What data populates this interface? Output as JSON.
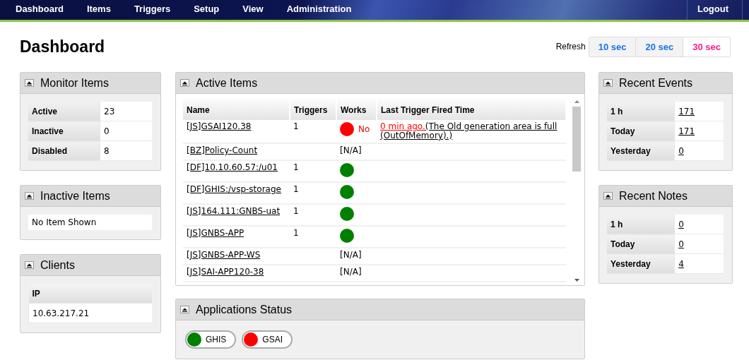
{
  "nav": {
    "items": [
      {
        "label": "Dashboard"
      },
      {
        "label": "Items"
      },
      {
        "label": "Triggers"
      },
      {
        "label": "Setup"
      },
      {
        "label": "View"
      },
      {
        "label": "Administration"
      }
    ],
    "logout": "Logout"
  },
  "page_title": "Dashboard",
  "refresh": {
    "label": "Refresh",
    "options": [
      {
        "label": "10 sec",
        "selected": false
      },
      {
        "label": "20 sec",
        "selected": false
      },
      {
        "label": "30 sec",
        "selected": true
      }
    ]
  },
  "monitor_items": {
    "title": "Monitor Items",
    "rows": [
      {
        "label": "Active",
        "value": "23"
      },
      {
        "label": "Inactive",
        "value": "0"
      },
      {
        "label": "Disabled",
        "value": "8"
      }
    ]
  },
  "inactive_items": {
    "title": "Inactive Items",
    "message": "No Item Shown"
  },
  "clients": {
    "title": "Clients",
    "column": "IP",
    "rows": [
      "10.63.217.21"
    ]
  },
  "active_items": {
    "title": "Active Items",
    "columns": [
      "Name",
      "Triggers",
      "Works",
      "Last Trigger Fired Time"
    ],
    "rows": [
      {
        "name": "[JS]GSAI120.38",
        "triggers": "1",
        "works": {
          "kind": "dot",
          "color": "#ff0000",
          "label": "No"
        },
        "last_trigger": {
          "time": "0 min ago.",
          "message": "(The Old generation area is full (OutOfMemory).)"
        }
      },
      {
        "name": "[BZ]Policy-Count",
        "works": {
          "kind": "text",
          "label": "[N/A]"
        }
      },
      {
        "name": "[DF]10.10.60.57:/u01",
        "triggers": "1",
        "works": {
          "kind": "dot",
          "color": "#008000"
        }
      },
      {
        "name": "[DF]GHIS:/vsp-storage",
        "triggers": "1",
        "works": {
          "kind": "dot",
          "color": "#008000"
        }
      },
      {
        "name": "[JS]164.111:GNBS-uat",
        "triggers": "1",
        "works": {
          "kind": "dot",
          "color": "#008000"
        }
      },
      {
        "name": "[JS]GNBS-APP",
        "triggers": "1",
        "works": {
          "kind": "dot",
          "color": "#008000"
        }
      },
      {
        "name": "[JS]GNBS-APP-WS",
        "works": {
          "kind": "text",
          "label": "[N/A]"
        }
      },
      {
        "name": "[JS]SAI-APP120-38",
        "works": {
          "kind": "text",
          "label": "[N/A]"
        }
      }
    ]
  },
  "applications_status": {
    "title": "Applications Status",
    "apps": [
      {
        "name": "GHIS",
        "color": "#008000"
      },
      {
        "name": "GSAI",
        "color": "#ff0000"
      }
    ]
  },
  "recent_events": {
    "title": "Recent Events",
    "rows": [
      {
        "label": "1 h",
        "value": "171"
      },
      {
        "label": "Today",
        "value": "171"
      },
      {
        "label": "Yesterday",
        "value": "0"
      }
    ]
  },
  "recent_notes": {
    "title": "Recent Notes",
    "rows": [
      {
        "label": "1 h",
        "value": "0"
      },
      {
        "label": "Today",
        "value": "0"
      },
      {
        "label": "Yesterday",
        "value": "4"
      }
    ]
  }
}
